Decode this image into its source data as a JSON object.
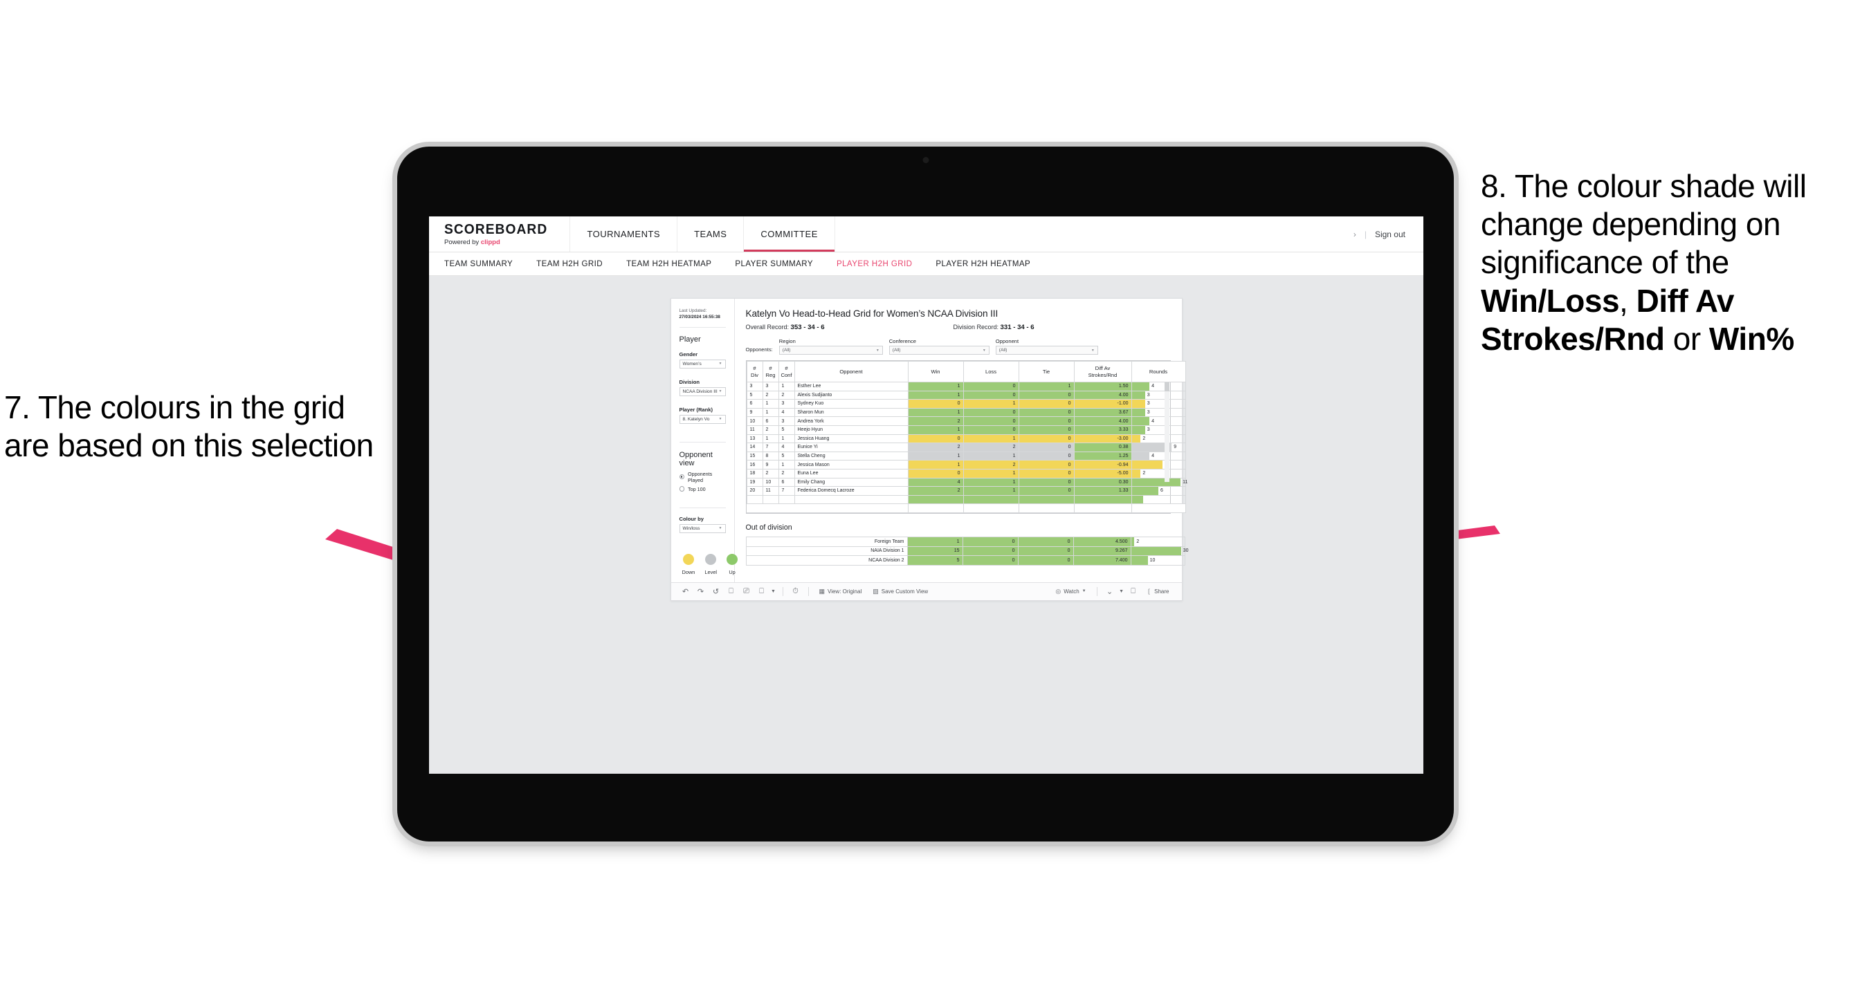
{
  "annotations": {
    "left": "7. The colours in the grid are based on this selection",
    "right_prefix": "8. The colour shade will change depending on significance of the ",
    "right_bold1": "Win/Loss",
    "right_mid1": ", ",
    "right_bold2": "Diff Av Strokes/Rnd",
    "right_mid2": " or ",
    "right_bold3": "Win%",
    "accent": "#e8316a"
  },
  "header": {
    "brand_title": "SCOREBOARD",
    "brand_sub_prefix": "Powered by ",
    "brand_sub_name": "clippd",
    "nav": [
      {
        "label": "TOURNAMENTS",
        "active": false
      },
      {
        "label": "TEAMS",
        "active": false
      },
      {
        "label": "COMMITTEE",
        "active": true
      }
    ],
    "chevron": "›",
    "separator": "|",
    "sign_out": "Sign out"
  },
  "subnav": {
    "items": [
      {
        "label": "TEAM SUMMARY",
        "active": false
      },
      {
        "label": "TEAM H2H GRID",
        "active": false
      },
      {
        "label": "TEAM H2H HEATMAP",
        "active": false
      },
      {
        "label": "PLAYER SUMMARY",
        "active": false
      },
      {
        "label": "PLAYER H2H GRID",
        "active": true
      },
      {
        "label": "PLAYER H2H HEATMAP",
        "active": false
      }
    ]
  },
  "filter_pane": {
    "last_updated_label": "Last Updated: ",
    "last_updated_value": "27/03/2024 16:55:38",
    "section_player": "Player",
    "gender_label": "Gender",
    "gender_value": "Women’s",
    "division_label": "Division",
    "division_value": "NCAA Division III",
    "player_rank_label": "Player (Rank)",
    "player_rank_value": "8. Katelyn Vo",
    "opponent_view_label": "Opponent view",
    "opponent_view_options": [
      {
        "label": "Opponents Played",
        "selected": true
      },
      {
        "label": "Top 100",
        "selected": false
      }
    ],
    "colour_by_label": "Colour by",
    "colour_by_value": "Win/loss",
    "legend": [
      {
        "label": "Down",
        "color": "#f2d658"
      },
      {
        "label": "Level",
        "color": "#c2c5c8"
      },
      {
        "label": "Up",
        "color": "#8dc96a"
      }
    ]
  },
  "view": {
    "title": "Katelyn Vo Head-to-Head Grid for Women’s NCAA Division III",
    "overall_record_label": "Overall Record: ",
    "overall_record_value": "353 -  34 - 6",
    "division_record_label": "Division Record: ",
    "division_record_value": "331 -  34 - 6",
    "opponents_label": "Opponents:",
    "filters": [
      {
        "caption": "Region",
        "value": "(All)"
      },
      {
        "caption": "Conference",
        "value": "(All)"
      },
      {
        "caption": "Opponent",
        "value": "(All)"
      }
    ]
  },
  "chart_data": {
    "type": "table",
    "title": "Katelyn Vo Head-to-Head Grid for Women’s NCAA Division III",
    "columns": [
      "# Div",
      "# Reg",
      "# Conf",
      "Opponent",
      "Win",
      "Loss",
      "Tie",
      "Diff Av Strokes/Rnd",
      "Rounds"
    ],
    "rounds_max": 12,
    "rows": [
      {
        "div": "3",
        "reg": "3",
        "conf": "1",
        "opponent": "Esther Lee",
        "win": "1",
        "loss": "0",
        "tie": "1",
        "diff": "1.50",
        "rounds": "4",
        "rounds_n": 4,
        "color": "green"
      },
      {
        "div": "5",
        "reg": "2",
        "conf": "2",
        "opponent": "Alexis Sudjianto",
        "win": "1",
        "loss": "0",
        "tie": "0",
        "diff": "4.00",
        "rounds": "3",
        "rounds_n": 3,
        "color": "green"
      },
      {
        "div": "6",
        "reg": "1",
        "conf": "3",
        "opponent": "Sydney Kuo",
        "win": "0",
        "loss": "1",
        "tie": "0",
        "diff": "-1.00",
        "rounds": "3",
        "rounds_n": 3,
        "color": "yellow"
      },
      {
        "div": "9",
        "reg": "1",
        "conf": "4",
        "opponent": "Sharon Mun",
        "win": "1",
        "loss": "0",
        "tie": "0",
        "diff": "3.67",
        "rounds": "3",
        "rounds_n": 3,
        "color": "green"
      },
      {
        "div": "10",
        "reg": "6",
        "conf": "3",
        "opponent": "Andrea York",
        "win": "2",
        "loss": "0",
        "tie": "0",
        "diff": "4.00",
        "rounds": "4",
        "rounds_n": 4,
        "color": "green"
      },
      {
        "div": "11",
        "reg": "2",
        "conf": "5",
        "opponent": "Heejo Hyun",
        "win": "1",
        "loss": "0",
        "tie": "0",
        "diff": "3.33",
        "rounds": "3",
        "rounds_n": 3,
        "color": "green"
      },
      {
        "div": "13",
        "reg": "1",
        "conf": "1",
        "opponent": "Jessica Huang",
        "win": "0",
        "loss": "1",
        "tie": "0",
        "diff": "-3.00",
        "rounds": "2",
        "rounds_n": 2,
        "color": "yellow"
      },
      {
        "div": "14",
        "reg": "7",
        "conf": "4",
        "opponent": "Eunice Yi",
        "win": "2",
        "loss": "2",
        "tie": "0",
        "diff": "0.38",
        "rounds": "9",
        "rounds_n": 9,
        "color": "grey",
        "diff_color": "green"
      },
      {
        "div": "15",
        "reg": "8",
        "conf": "5",
        "opponent": "Stella Cheng",
        "win": "1",
        "loss": "1",
        "tie": "0",
        "diff": "1.25",
        "rounds": "4",
        "rounds_n": 4,
        "color": "grey",
        "diff_color": "green"
      },
      {
        "div": "16",
        "reg": "9",
        "conf": "1",
        "opponent": "Jessica Mason",
        "win": "1",
        "loss": "2",
        "tie": "0",
        "diff": "-0.94",
        "rounds": "7",
        "rounds_n": 7,
        "color": "yellow"
      },
      {
        "div": "18",
        "reg": "2",
        "conf": "2",
        "opponent": "Euna Lee",
        "win": "0",
        "loss": "1",
        "tie": "0",
        "diff": "-5.00",
        "rounds": "2",
        "rounds_n": 2,
        "color": "yellow"
      },
      {
        "div": "19",
        "reg": "10",
        "conf": "6",
        "opponent": "Emily Chang",
        "win": "4",
        "loss": "1",
        "tie": "0",
        "diff": "0.30",
        "rounds": "11",
        "rounds_n": 11,
        "color": "green"
      },
      {
        "div": "20",
        "reg": "11",
        "conf": "7",
        "opponent": "Federica Domecq Lacroze",
        "win": "2",
        "loss": "1",
        "tie": "0",
        "diff": "1.33",
        "rounds": "6",
        "rounds_n": 6,
        "color": "green"
      }
    ]
  },
  "out_of_division": {
    "title": "Out of division",
    "rounds_max": 32,
    "rows": [
      {
        "name": "Foreign Team",
        "win": "1",
        "loss": "0",
        "tie": "0",
        "diff": "4.500",
        "rounds": "2",
        "rounds_n": 2,
        "color": "green"
      },
      {
        "name": "NAIA Division 1",
        "win": "15",
        "loss": "0",
        "tie": "0",
        "diff": "9.267",
        "rounds": "30",
        "rounds_n": 30,
        "color": "green"
      },
      {
        "name": "NCAA Division 2",
        "win": "5",
        "loss": "0",
        "tie": "0",
        "diff": "7.400",
        "rounds": "10",
        "rounds_n": 10,
        "color": "green"
      }
    ]
  },
  "toolbar": {
    "icons": [
      "undo-icon",
      "redo-icon",
      "revert-icon",
      "refresh-icon",
      "pause-icon",
      "dashboard-icon",
      "chevron-down-icon"
    ],
    "glyphs": {
      "undo": "↶",
      "redo": "↷",
      "revert": "↺",
      "refresh": "⟳",
      "pause": "⏸",
      "dashboard": "⬜",
      "caret": "▾",
      "clock": "◷",
      "view": "▤",
      "save": "☰",
      "watch": "◎",
      "download": "⤓",
      "fullscreen": "⛶",
      "share": "⤢"
    },
    "view_label": "View: Original",
    "save_label": "Save Custom View",
    "watch_label": "Watch",
    "share_label": "Share"
  }
}
